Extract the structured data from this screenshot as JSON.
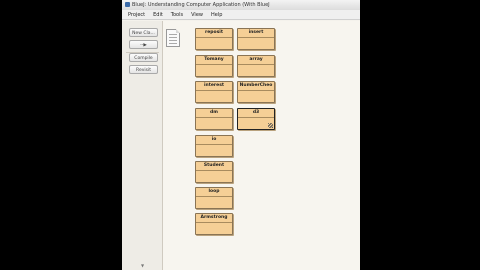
{
  "window": {
    "title": "BlueJ: Understanding Computer Application (With BlueJ"
  },
  "menu": [
    "Project",
    "Edit",
    "Tools",
    "View",
    "Help"
  ],
  "sidebar": {
    "buttons": [
      {
        "id": "new_class",
        "label": "New Cla..."
      },
      {
        "id": "arrow",
        "label": "--▶"
      },
      {
        "id": "compile",
        "label": "Compile"
      },
      {
        "id": "tools",
        "label": "Revisit"
      }
    ]
  },
  "classes": [
    {
      "name": "reposit",
      "selected": false
    },
    {
      "name": "insert",
      "selected": false
    },
    {
      "name": "Tomany",
      "selected": false
    },
    {
      "name": "array",
      "selected": false
    },
    {
      "name": "interest",
      "selected": false
    },
    {
      "name": "NumberCheo",
      "selected": false
    },
    {
      "name": "dm",
      "selected": false
    },
    {
      "name": "d3",
      "selected": true
    },
    {
      "name": "io",
      "selected": false
    },
    {
      "name": "Student",
      "selected": false
    },
    {
      "name": "loop",
      "selected": false
    },
    {
      "name": "Armstrong",
      "selected": false
    }
  ],
  "colors": {
    "class_fill": "#f5cf96",
    "class_border": "#8a7454",
    "canvas": "#f7f5ef"
  }
}
